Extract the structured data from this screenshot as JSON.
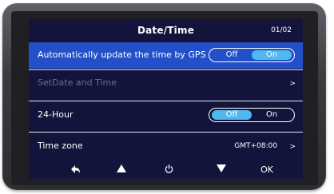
{
  "header": {
    "title": "Date/Time",
    "page_indicator": "01/02"
  },
  "rows": {
    "auto_update": {
      "label": "Automatically update the time by GPS",
      "toggle_off": "Off",
      "toggle_on": "On",
      "selected_value": "On"
    },
    "set_date": {
      "label": "SetDate and Time",
      "chevron": ">"
    },
    "hour_format": {
      "label": "24-Hour",
      "toggle_off": "Off",
      "toggle_on": "On",
      "selected_value": "Off"
    },
    "time_zone": {
      "label": "Time zone",
      "value": "GMT+08:00",
      "chevron": ">"
    }
  },
  "bottom_nav": {
    "back_icon": "back-arrow-icon",
    "up_icon": "triangle-up-icon",
    "power_icon": "power-icon",
    "down_icon": "triangle-down-icon",
    "ok_label": "OK"
  },
  "colors": {
    "screen_bg": "#12143b",
    "selected_row": "#2350c9",
    "toggle_active": "#4fb8ee",
    "disabled_text": "#6d6f88"
  }
}
